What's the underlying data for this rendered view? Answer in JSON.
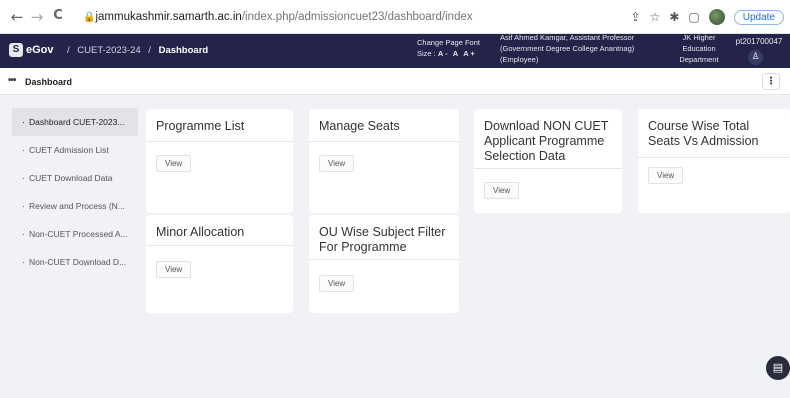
{
  "browser": {
    "back_glyph": "←",
    "forward_glyph": "→",
    "reload_glyph": "C",
    "url_host": "jammukashmir.samarth.ac.in",
    "url_path": "/index.php/admissioncuet23/dashboard/index",
    "update_label": "Update"
  },
  "header": {
    "logo_mark": "S",
    "logo_text": "eGov",
    "breadcrumb_project": "CUET-2023-24",
    "breadcrumb_separator": "/",
    "breadcrumb_current": "Dashboard",
    "font_label_1": "Change Page Font",
    "font_label_2": "Size :",
    "font_decrease": "A -",
    "font_normal": "A",
    "font_increase": "A +",
    "user_line1": "Asif Ahmed Kamgar, Assistant Professor",
    "user_line2": "(Government Degree College Anantnag)",
    "user_line3": "(Employee)",
    "dept_line1": "JK Higher",
    "dept_line2": "Education",
    "dept_line3": "Department",
    "user_id": "pt201700047"
  },
  "subheader": {
    "menu_glyph": "•••",
    "title": "Dashboard",
    "options_glyph": "⋮"
  },
  "sidebar": {
    "items": [
      {
        "label": "Dashboard CUET-2023..."
      },
      {
        "label": "CUET Admission List"
      },
      {
        "label": "CUET Download Data"
      },
      {
        "label": "Review and Process (N..."
      },
      {
        "label": "Non-CUET Processed A..."
      },
      {
        "label": "Non-CUET Download D..."
      }
    ]
  },
  "cards": [
    {
      "title": "Programme List",
      "button": "View"
    },
    {
      "title": "Manage Seats",
      "button": "View"
    },
    {
      "title": "Download NON CUET Applicant Programme Selection Data",
      "button": "View"
    },
    {
      "title": "Course Wise Total Seats Vs Admission",
      "button": "View"
    },
    {
      "title": "Minor Allocation",
      "button": "View"
    },
    {
      "title": "OU Wise Subject Filter For Programme",
      "button": "View"
    }
  ]
}
